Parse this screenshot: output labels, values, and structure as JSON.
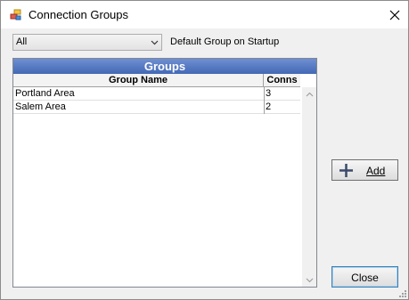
{
  "window": {
    "title": "Connection Groups",
    "icon": "connection-groups-app-icon",
    "close_icon": "close-x-icon"
  },
  "startup_group": {
    "selected_value": "All",
    "label": "Default Group on Startup"
  },
  "groups_grid": {
    "caption": "Groups",
    "columns": [
      "Group Name",
      "Conns"
    ],
    "rows": [
      {
        "name": "Portland Area",
        "conns": "3"
      },
      {
        "name": "Salem Area",
        "conns": "2"
      }
    ],
    "caption_color": "#4a6fbb"
  },
  "buttons": {
    "add_label": "Add",
    "add_icon": "plus-icon",
    "close_label": "Close"
  }
}
